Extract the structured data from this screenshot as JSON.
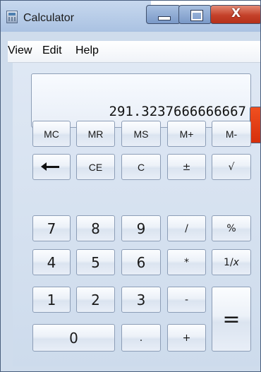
{
  "window": {
    "title": "Calculator",
    "close_glyph": "X"
  },
  "menu": {
    "items": [
      "View",
      "Edit",
      "Help"
    ]
  },
  "display": {
    "value": "291.3237666666667"
  },
  "buttons": {
    "memory": [
      "MC",
      "MR",
      "MS",
      "M+",
      "M-"
    ],
    "row2": {
      "backspace_icon": "backspace-arrow-icon",
      "ce": "CE",
      "c": "C",
      "sign": "±",
      "sqrt": "√"
    },
    "row3": [
      "7",
      "8",
      "9",
      "/",
      "%"
    ],
    "row4": [
      "4",
      "5",
      "6",
      "*"
    ],
    "reciprocal": {
      "prefix": "1/",
      "var": "x"
    },
    "row5": [
      "1",
      "2",
      "3",
      "-"
    ],
    "equals": "=",
    "row6": {
      "zero": "0",
      "dot": ".",
      "plus": "+"
    }
  },
  "colors": {
    "accent_tab": "#e8451a",
    "close_button": "#c4412a"
  }
}
